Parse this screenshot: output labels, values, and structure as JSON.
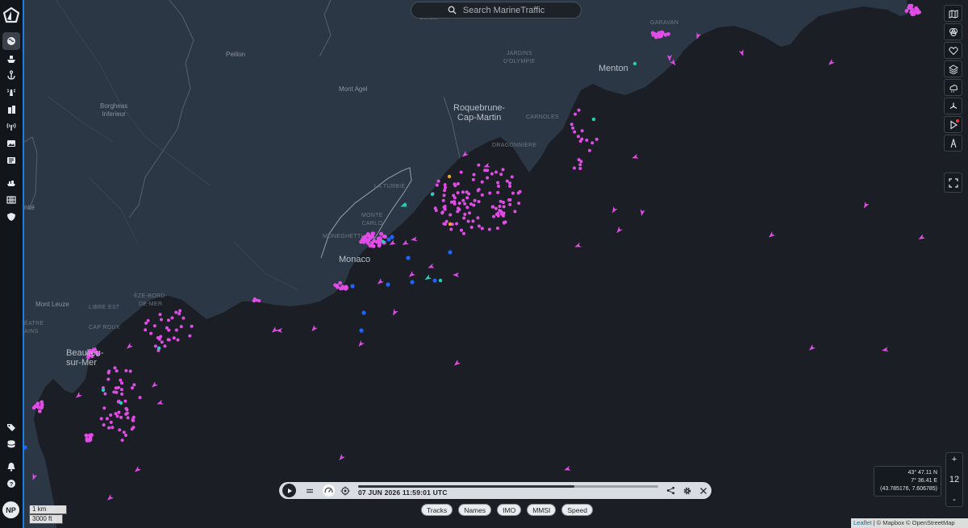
{
  "search": {
    "placeholder": "Search MarineTraffic"
  },
  "user": {
    "initials": "NP"
  },
  "sidebar": {
    "items": [
      {
        "icon": "globe-icon",
        "active": true
      },
      {
        "icon": "ship-icon"
      },
      {
        "icon": "anchor-icon"
      },
      {
        "icon": "lighthouse-icon"
      },
      {
        "icon": "building-icon"
      },
      {
        "icon": "antenna-icon"
      },
      {
        "icon": "photo-icon"
      },
      {
        "icon": "news-icon"
      },
      {
        "icon": "fleet-icon"
      },
      {
        "icon": "grid-icon"
      },
      {
        "icon": "shield-icon"
      }
    ],
    "bottom_items": [
      {
        "icon": "tag-icon"
      },
      {
        "icon": "database-icon"
      },
      {
        "icon": "bell-icon"
      },
      {
        "icon": "help-icon"
      }
    ]
  },
  "right_toolbar": {
    "items": [
      "map-icon",
      "filter-icon",
      "heart-icon",
      "layers-icon",
      "weather-icon",
      "wind-icon",
      "play-route-icon",
      "measure-icon"
    ],
    "fullscreen": "fullscreen-icon"
  },
  "map": {
    "places": [
      {
        "name": "Peillon",
        "big": false
      },
      {
        "name": "Mont Agel",
        "big": false
      },
      {
        "name": "Borgheas\nInferieur",
        "big": false
      },
      {
        "name": "Menton",
        "big": true
      },
      {
        "name": "Roquebrune-\nCap-Martin",
        "big": true
      },
      {
        "name": "Monaco",
        "big": true
      },
      {
        "name": "Beaulieu-\nsur-Mer",
        "big": true
      },
      {
        "name": "Mont Leuze",
        "big": false
      },
      {
        "name": "GARAVAN",
        "big": false
      },
      {
        "name": "JARDINS\nD'OLYMPIE",
        "big": false
      },
      {
        "name": "CARNOLES",
        "big": false
      },
      {
        "name": "DRAGONNIERE",
        "big": false
      },
      {
        "name": "LA TURBIE",
        "big": false
      },
      {
        "name": "MONTE\nCARLO",
        "big": false
      },
      {
        "name": "MONEGHETTI",
        "big": false
      },
      {
        "name": "ÈZE-BORD-\nDE-MER",
        "big": false
      },
      {
        "name": "LIBRE EST",
        "big": false
      },
      {
        "name": "CAP ROUX",
        "big": false
      },
      {
        "name": "nité",
        "big": false
      },
      {
        "name": "ÉATRE\nAINS",
        "big": false
      },
      {
        "name": "Gorbio",
        "big": false
      }
    ],
    "colors": {
      "sea": "#1b1f25",
      "land": "#2c3745",
      "vessel_pleasure": "#e14ce6",
      "vessel_cargo": "#1e63ff",
      "vessel_tug": "#1fd3b6",
      "vessel_special": "#f5a623"
    },
    "zoom_level": "12",
    "zoom_in": "+",
    "zoom_out": "-",
    "scale_metric": "1 km",
    "scale_imperial": "3000 ft"
  },
  "coordinates": {
    "lat": "43° 47.11 N",
    "lon": "7° 36.41 E",
    "decimal": "(43.785176, 7.606785)"
  },
  "playback": {
    "timestamp": "07 JUN 2026 11:59:01 UTC",
    "progress": 0.72
  },
  "filters": {
    "chips": [
      "Tracks",
      "Names",
      "IMO",
      "MMSI",
      "Speed"
    ]
  },
  "attribution": {
    "leaflet": "Leaflet",
    "rest": " | © Mapbox © OpenStreetMap"
  }
}
